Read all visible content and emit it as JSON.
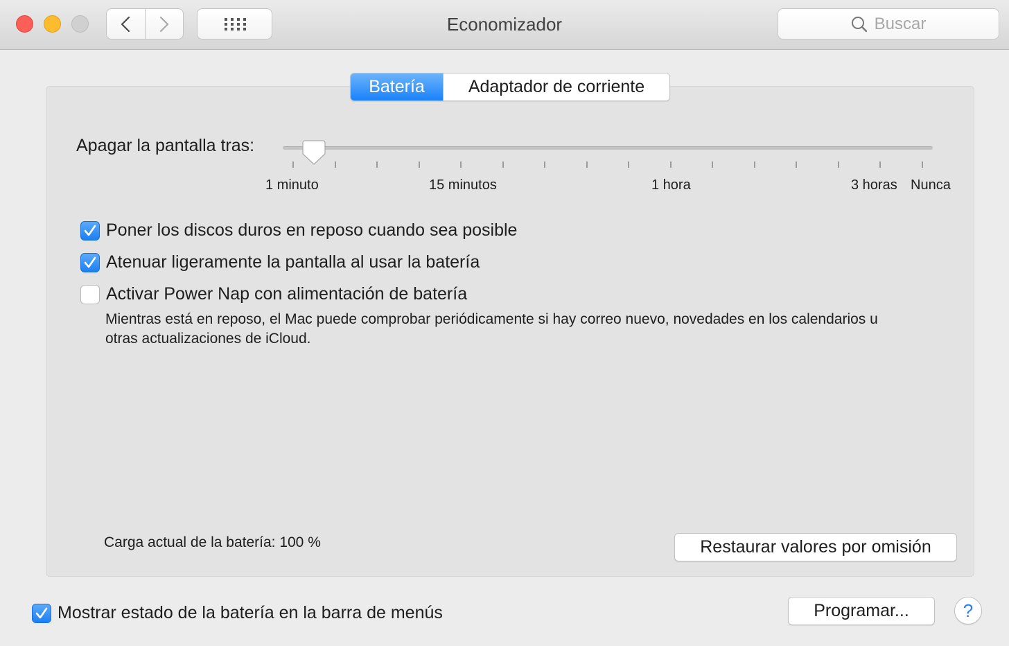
{
  "window": {
    "title": "Economizador",
    "search_placeholder": "Buscar"
  },
  "tabs": [
    {
      "label": "Batería",
      "active": true
    },
    {
      "label": "Adaptador de corriente",
      "active": false
    }
  ],
  "slider": {
    "label": "Apagar la pantalla tras:",
    "tick_labels": [
      "1 minuto",
      "15 minutos",
      "1 hora",
      "3 horas",
      "Nunca"
    ],
    "selected_value": "2 minutos"
  },
  "options": [
    {
      "label": "Poner los discos duros en reposo cuando sea posible",
      "checked": true
    },
    {
      "label": "Atenuar ligeramente la pantalla al usar la batería",
      "checked": true
    },
    {
      "label": "Activar Power Nap con alimentación de batería",
      "checked": false,
      "description": "Mientras está en reposo, el Mac puede comprobar periódicamente si hay correo nuevo, novedades en los calendarios u otras actualizaciones de iCloud."
    }
  ],
  "battery_charge": "Carga actual de la batería: 100 %",
  "restore_button": "Restaurar valores por omisión",
  "menubar_option": {
    "label": "Mostrar estado de la batería en la barra de menús",
    "checked": true
  },
  "schedule_button": "Programar...",
  "help_button": "?",
  "colors": {
    "accent": "#1a82fb",
    "close": "#fc5f57",
    "minimize": "#fdbc2e"
  }
}
